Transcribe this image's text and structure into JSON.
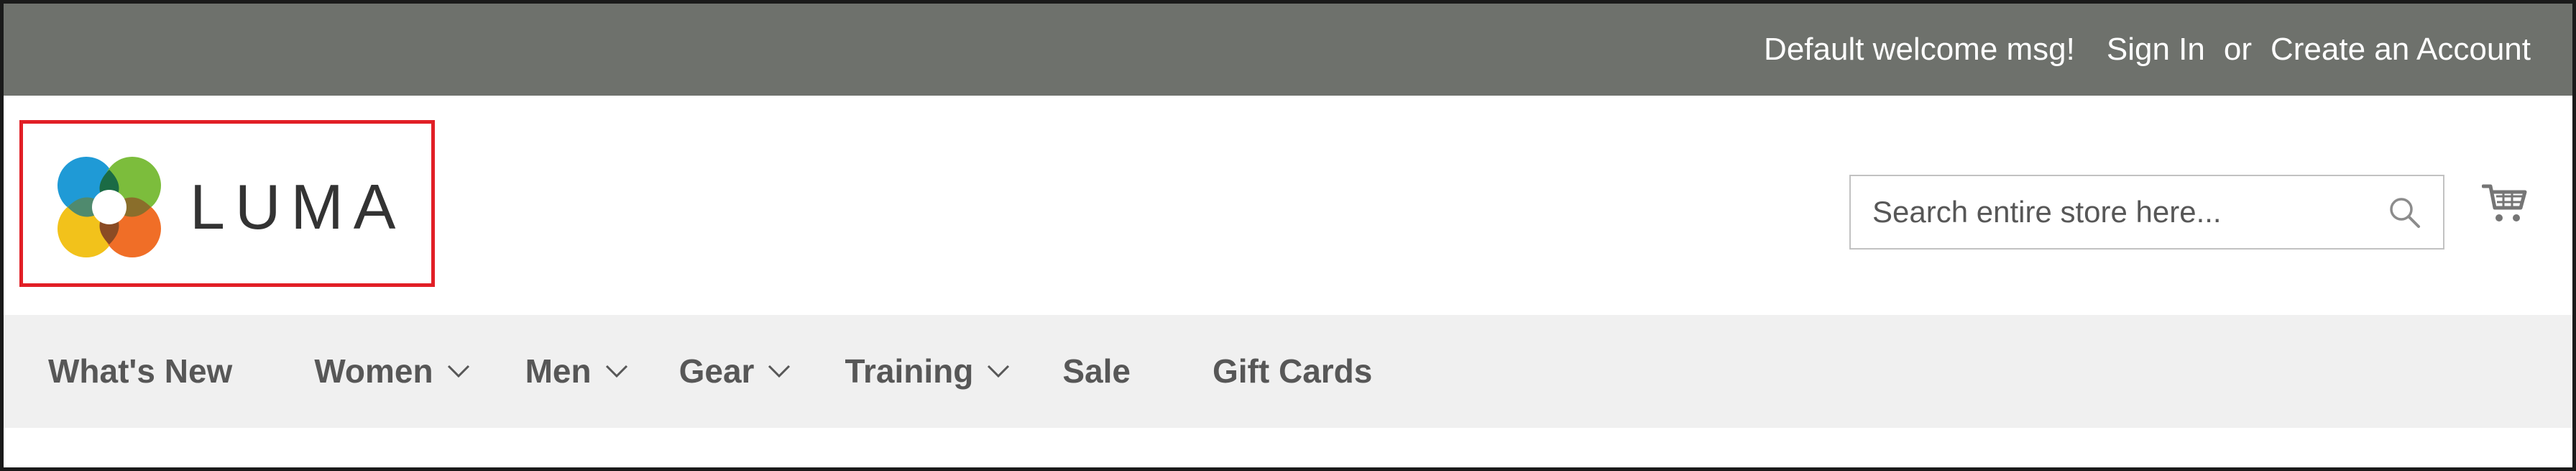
{
  "top_bar": {
    "welcome": "Default welcome msg!",
    "sign_in": "Sign In",
    "or": "or",
    "create_account": "Create an Account"
  },
  "logo": {
    "text": "LUMA"
  },
  "search": {
    "placeholder": "Search entire store here..."
  },
  "nav": {
    "items": [
      {
        "label": "What's New",
        "has_dropdown": false
      },
      {
        "label": "Women",
        "has_dropdown": true
      },
      {
        "label": "Men",
        "has_dropdown": true
      },
      {
        "label": "Gear",
        "has_dropdown": true
      },
      {
        "label": "Training",
        "has_dropdown": true
      },
      {
        "label": "Sale",
        "has_dropdown": false
      },
      {
        "label": "Gift Cards",
        "has_dropdown": false
      }
    ]
  },
  "icons": {
    "search": "search-icon",
    "cart": "cart-icon",
    "dropdown": "chevron-down-icon"
  },
  "colors": {
    "top_bar": "#6e716c",
    "nav_bar": "#f0f0f0",
    "highlight_border": "#e11f26",
    "logo_blue": "#1f9ad6",
    "logo_green": "#7cbd3c",
    "logo_yellow": "#f2c21b",
    "logo_orange": "#f06e27"
  }
}
